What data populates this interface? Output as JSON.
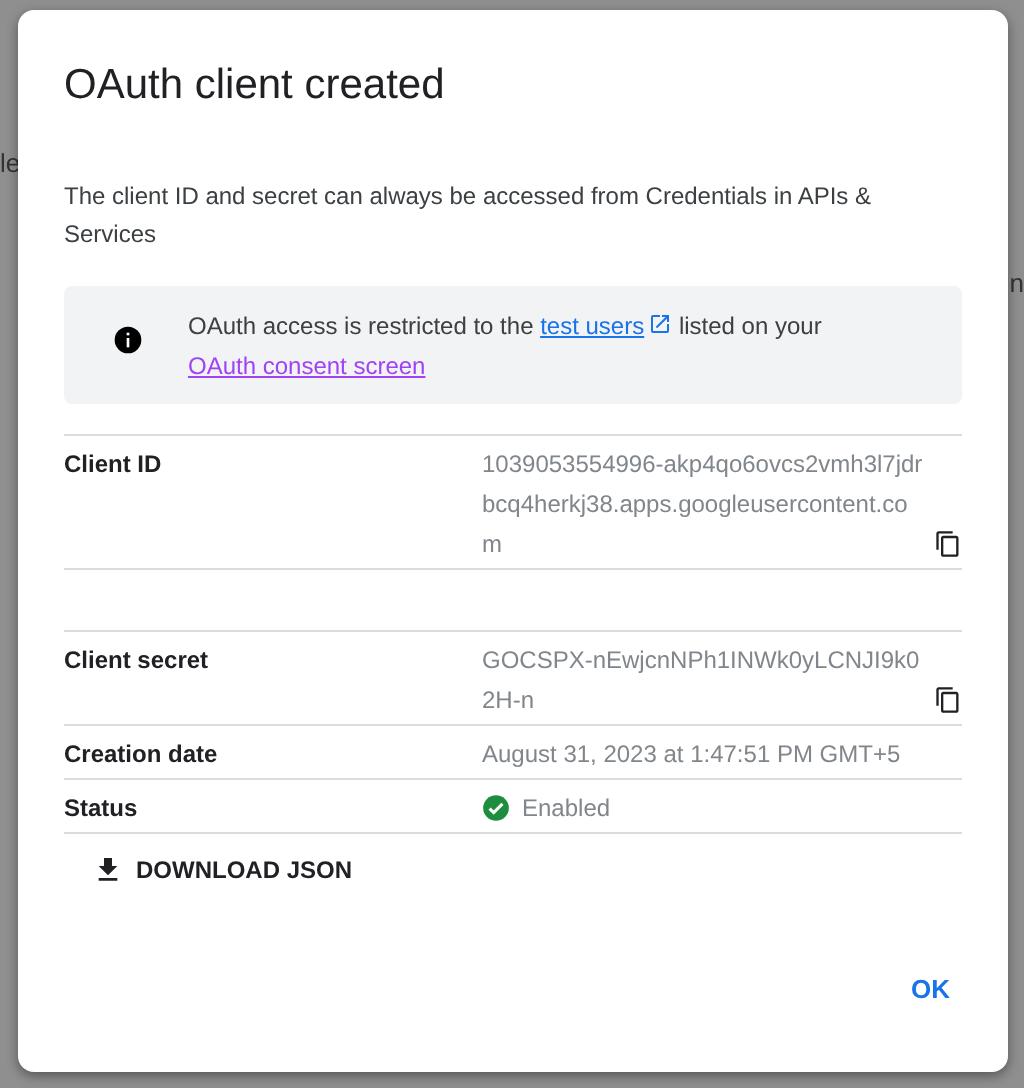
{
  "background": {
    "left_fragment": "le",
    "right_fragment": "n"
  },
  "dialog": {
    "title": "OAuth client created",
    "description": "The client ID and secret can always be accessed from Credentials in APIs & Services",
    "notice": [
      {
        "kind": "text",
        "text": "OAuth access is restricted to the "
      },
      {
        "kind": "link",
        "text": "test users",
        "external": true,
        "visited": false
      },
      {
        "kind": "text",
        "text": " listed on your "
      },
      {
        "kind": "link",
        "text": "OAuth consent screen",
        "external": false,
        "visited": true
      }
    ],
    "fields": [
      {
        "label": "Client ID",
        "kind": "text",
        "value": "1039053554996-akp4qo6ovcs2vmh3l7jdrbcq4herkj38.apps.googleusercontent.com",
        "copyable": true
      },
      {
        "label": "Client secret",
        "kind": "text",
        "value": "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",
        "copyable": true
      },
      {
        "label": "Creation date",
        "kind": "text",
        "value": "August 31, 2023 at 1:47:51 PM GMT+5",
        "copyable": false
      },
      {
        "label": "Status",
        "kind": "status",
        "value": "Enabled",
        "copyable": false
      }
    ],
    "download_button": "DOWNLOAD JSON",
    "ok_button": "OK"
  }
}
